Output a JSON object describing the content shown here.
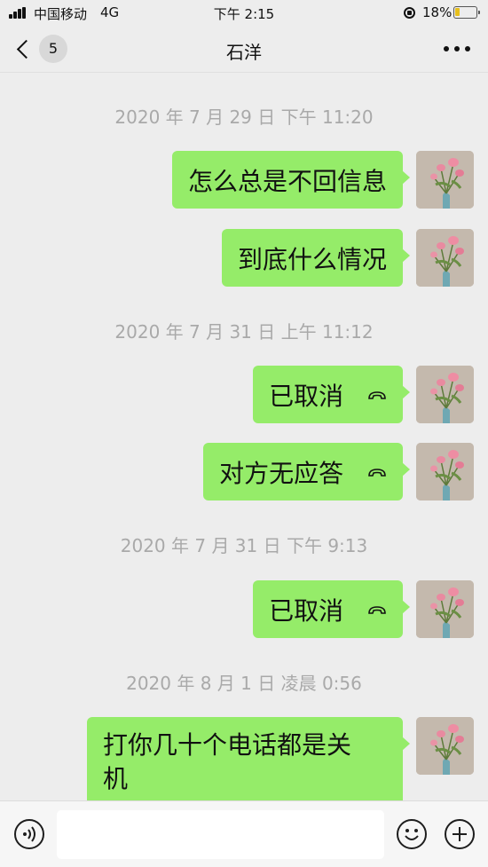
{
  "status_bar": {
    "carrier": "中国移动",
    "network": "4G",
    "time": "下午 2:15",
    "battery_percent": "18%",
    "battery_level": 0.18,
    "battery_color": "#e7bf1c"
  },
  "header": {
    "back_badge": "5",
    "title": "石洋",
    "more_icon": "more-dots-icon"
  },
  "messages": [
    {
      "type": "timestamp",
      "text": "2020 年 7 月 29 日 下午 11:20"
    },
    {
      "type": "text",
      "from": "me",
      "text": "怎么总是不回信息"
    },
    {
      "type": "text",
      "from": "me",
      "text": "到底什么情况"
    },
    {
      "type": "timestamp",
      "text": "2020 年 7 月 31 日 上午 11:12"
    },
    {
      "type": "call",
      "from": "me",
      "text": "已取消",
      "icon": "hangup-icon"
    },
    {
      "type": "call",
      "from": "me",
      "text": "对方无应答",
      "icon": "hangup-icon"
    },
    {
      "type": "timestamp",
      "text": "2020 年 7 月 31 日 下午 9:13"
    },
    {
      "type": "call",
      "from": "me",
      "text": "已取消",
      "icon": "hangup-icon"
    },
    {
      "type": "timestamp",
      "text": "2020 年 8 月 1 日 凌晨 0:56"
    },
    {
      "type": "text",
      "from": "me",
      "text_line1": "打你几十个电话都是关",
      "text_line2": "机"
    }
  ],
  "input_bar": {
    "voice_icon": "voice-icon",
    "emoji_icon": "emoji-icon",
    "plus_icon": "plus-icon",
    "input_value": ""
  },
  "colors": {
    "bubble_me": "#95ec69",
    "background": "#ededed",
    "timestamp_text": "#a9a9a9"
  }
}
